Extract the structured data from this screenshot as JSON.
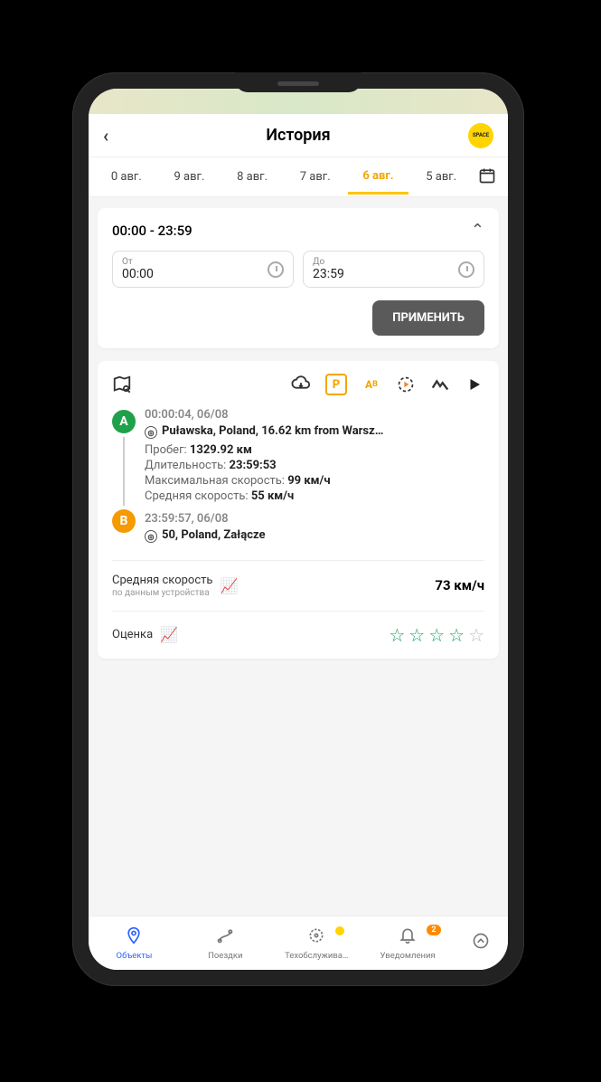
{
  "header": {
    "title": "История",
    "brand": "SPACE"
  },
  "tabs": {
    "items": [
      "0 авг.",
      "9 авг.",
      "8 авг.",
      "7 авг.",
      "6 авг.",
      "5 авг."
    ],
    "active_index": 4
  },
  "time_panel": {
    "range_label": "00:00 - 23:59",
    "from_label": "От",
    "from_value": "00:00",
    "to_label": "До",
    "to_value": "23:59",
    "apply_label": "ПРИМЕНИТЬ"
  },
  "trip": {
    "a": {
      "timestamp": "00:00:04, 06/08",
      "location": "Puławska, Poland, 16.62 km from Warsz…"
    },
    "stats": {
      "mileage_label": "Пробег:",
      "mileage_value": "1329.92 км",
      "duration_label": "Длительность:",
      "duration_value": "23:59:53",
      "max_speed_label": "Максимальная скорость:",
      "max_speed_value": "99 км/ч",
      "avg_speed_label": "Средняя скорость:",
      "avg_speed_value": "55 км/ч"
    },
    "b": {
      "timestamp": "23:59:57, 06/08",
      "location": "50, Poland, Załącze"
    }
  },
  "avg_speed_metric": {
    "title": "Средняя скорость",
    "subtitle": "по данным устройства",
    "value": "73 км/ч"
  },
  "rating": {
    "label": "Оценка",
    "stars_filled": 4,
    "stars_total": 5
  },
  "bottom_nav": {
    "items": [
      {
        "label": "Объекты"
      },
      {
        "label": "Поездки"
      },
      {
        "label": "Техобслужива…"
      },
      {
        "label": "Уведомления",
        "badge": "2"
      }
    ],
    "active_index": 0
  }
}
